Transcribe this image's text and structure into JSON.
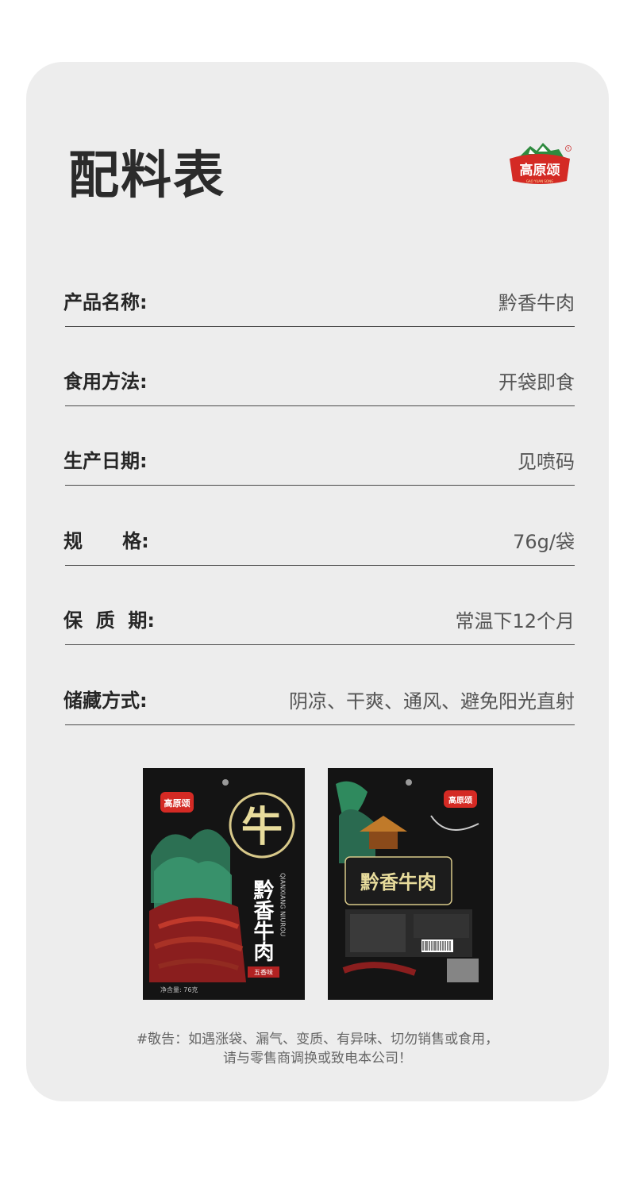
{
  "title": "配料表",
  "brand": {
    "logo_text": "高原颂",
    "logo_subtext": "GAO YUAN SONG"
  },
  "rows": [
    {
      "label": "产品名称:",
      "value": "黔香牛肉"
    },
    {
      "label": "食用方法:",
      "value": "开袋即食"
    },
    {
      "label": "生产日期:",
      "value": "见喷码"
    },
    {
      "label": "规      格:",
      "value": "76g/袋"
    },
    {
      "label": "保  质  期:",
      "value": "常温下12个月"
    },
    {
      "label": "储藏方式:",
      "value": "阴凉、干爽、通风、避免阳光直射"
    }
  ],
  "package_front": {
    "brand": "高原颂",
    "big_char": "牛",
    "name": "黔香牛肉",
    "pinyin": "QIANXIANG NIUROU",
    "flavor": "五香味",
    "net_weight": "净含量: 76克"
  },
  "package_back": {
    "brand": "高原颂",
    "name": "黔香牛肉"
  },
  "warning": {
    "line1": "#敬告：如遇涨袋、漏气、变质、有异味、切勿销售或食用，",
    "line2": "请与零售商调换或致电本公司！"
  },
  "colors": {
    "card_bg": "#ededed",
    "logo_red": "#d42a24",
    "logo_green": "#2e8a3e",
    "package_black": "#141414",
    "package_gold": "#d8c98a"
  }
}
